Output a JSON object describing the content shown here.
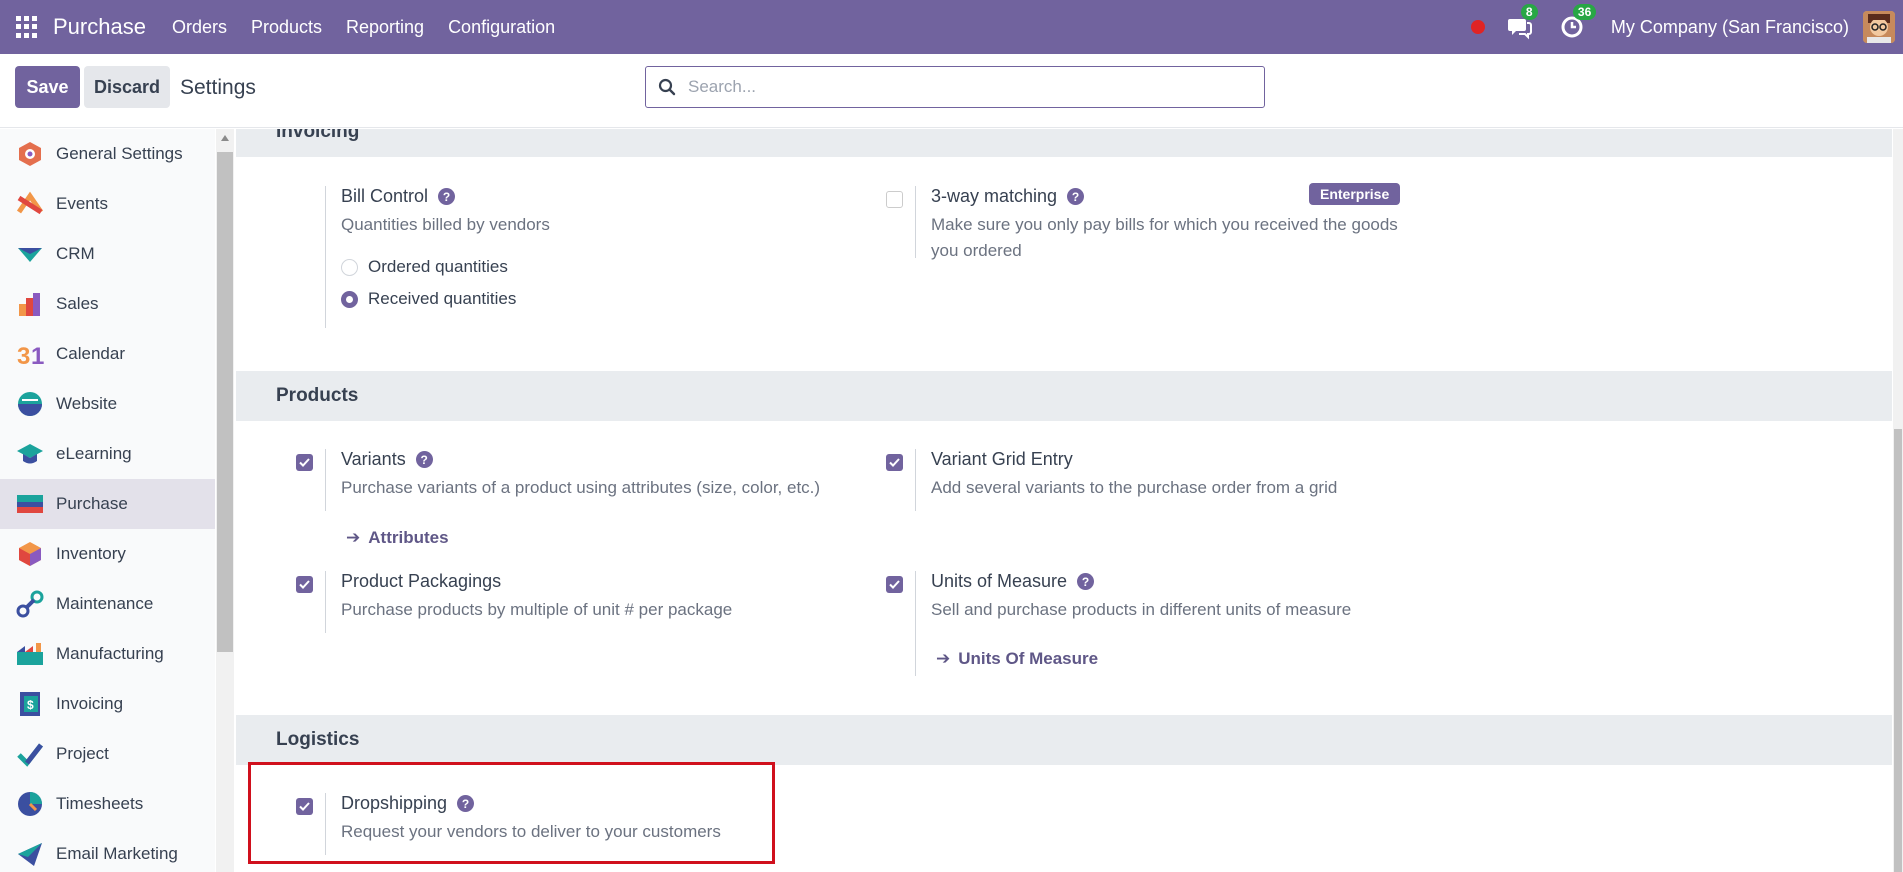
{
  "navbar": {
    "app_name": "Purchase",
    "menu": [
      "Orders",
      "Products",
      "Reporting",
      "Configuration"
    ],
    "messages_count": "8",
    "activities_count": "36",
    "company": "My Company (San Francisco)"
  },
  "control": {
    "save_label": "Save",
    "discard_label": "Discard",
    "title": "Settings",
    "search_placeholder": "Search..."
  },
  "sidebar": {
    "items": [
      {
        "label": "General Settings",
        "icon": "general-settings-icon"
      },
      {
        "label": "Events",
        "icon": "events-icon"
      },
      {
        "label": "CRM",
        "icon": "crm-icon"
      },
      {
        "label": "Sales",
        "icon": "sales-icon"
      },
      {
        "label": "Calendar",
        "icon": "calendar-icon"
      },
      {
        "label": "Website",
        "icon": "website-icon"
      },
      {
        "label": "eLearning",
        "icon": "elearning-icon"
      },
      {
        "label": "Purchase",
        "icon": "purchase-icon",
        "active": true
      },
      {
        "label": "Inventory",
        "icon": "inventory-icon"
      },
      {
        "label": "Maintenance",
        "icon": "maintenance-icon"
      },
      {
        "label": "Manufacturing",
        "icon": "manufacturing-icon"
      },
      {
        "label": "Invoicing",
        "icon": "invoicing-icon"
      },
      {
        "label": "Project",
        "icon": "project-icon"
      },
      {
        "label": "Timesheets",
        "icon": "timesheets-icon"
      },
      {
        "label": "Email Marketing",
        "icon": "email-marketing-icon"
      }
    ]
  },
  "sections": {
    "invoicing": {
      "header": "Invoicing",
      "bill_control": {
        "title": "Bill Control",
        "description": "Quantities billed by vendors",
        "options": [
          "Ordered quantities",
          "Received quantities"
        ],
        "selected": "Received quantities"
      },
      "three_way": {
        "title": "3-way matching",
        "description_line1": "Make sure you only pay bills for which you received the goods",
        "description_line2": "you ordered",
        "badge": "Enterprise",
        "checked": false
      }
    },
    "products": {
      "header": "Products",
      "variants": {
        "title": "Variants",
        "description": "Purchase variants of a product using attributes (size, color, etc.)",
        "link": "Attributes",
        "checked": true
      },
      "variant_grid": {
        "title": "Variant Grid Entry",
        "description": "Add several variants to the purchase order from a grid",
        "checked": true
      },
      "packagings": {
        "title": "Product Packagings",
        "description": "Purchase products by multiple of unit # per package",
        "checked": true
      },
      "uom": {
        "title": "Units of Measure",
        "description": "Sell and purchase products in different units of measure",
        "link": "Units Of Measure",
        "checked": true
      }
    },
    "logistics": {
      "header": "Logistics",
      "dropshipping": {
        "title": "Dropshipping",
        "description": "Request your vendors to deliver to your customers",
        "checked": true
      }
    }
  },
  "colors": {
    "brand": "#71639e",
    "section_bg": "#e9ecef",
    "highlight": "#d0101d",
    "badge_green": "#28a745"
  }
}
